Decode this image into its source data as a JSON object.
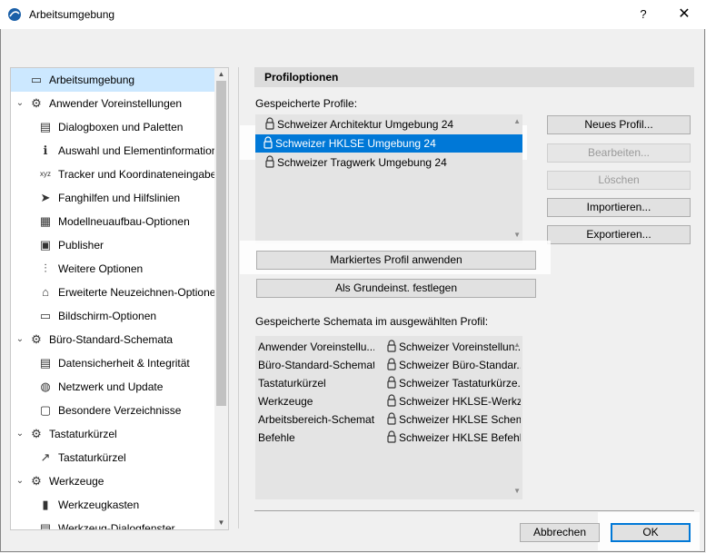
{
  "window": {
    "title": "Arbeitsumgebung",
    "help": "?",
    "close": "✕"
  },
  "tree": {
    "items": [
      {
        "label": "Arbeitsumgebung",
        "level": 0,
        "selected": true,
        "expander": "",
        "icon": "monitor-icon"
      },
      {
        "label": "Anwender Voreinstellungen",
        "level": 0,
        "expander": "⌄",
        "icon": "user-settings-icon"
      },
      {
        "label": "Dialogboxen und Paletten",
        "level": 1,
        "icon": "dialog-icon"
      },
      {
        "label": "Auswahl und Elementinformation",
        "level": 1,
        "icon": "selection-info-icon"
      },
      {
        "label": "Tracker und Koordinateneingabe",
        "level": 1,
        "icon": "xyz-icon"
      },
      {
        "label": "Fanghilfen und Hilfslinien",
        "level": 1,
        "icon": "cursor-icon"
      },
      {
        "label": "Modellneuaufbau-Optionen",
        "level": 1,
        "icon": "brick-icon"
      },
      {
        "label": "Publisher",
        "level": 1,
        "icon": "publisher-icon"
      },
      {
        "label": "Weitere Optionen",
        "level": 1,
        "icon": "sliders-icon"
      },
      {
        "label": "Erweiterte Neuzeichnen-Optionen",
        "level": 1,
        "icon": "house-icon"
      },
      {
        "label": "Bildschirm-Optionen",
        "level": 1,
        "icon": "screen-icon"
      },
      {
        "label": "Büro-Standard-Schemata",
        "level": 0,
        "expander": "⌄",
        "icon": "office-schema-icon"
      },
      {
        "label": "Datensicherheit & Integrität",
        "level": 1,
        "icon": "data-safety-icon"
      },
      {
        "label": "Netzwerk und Update",
        "level": 1,
        "icon": "globe-icon"
      },
      {
        "label": "Besondere Verzeichnisse",
        "level": 1,
        "icon": "folder-icon"
      },
      {
        "label": "Tastaturkürzel",
        "level": 0,
        "expander": "⌄",
        "icon": "keyboard-schema-icon"
      },
      {
        "label": "Tastaturkürzel",
        "level": 1,
        "icon": "shortcut-icon"
      },
      {
        "label": "Werkzeuge",
        "level": 0,
        "expander": "⌄",
        "icon": "tools-icon"
      },
      {
        "label": "Werkzeugkasten",
        "level": 1,
        "icon": "toolbox-icon"
      },
      {
        "label": "Werkzeug-Dialogfenster",
        "level": 1,
        "icon": "tool-dialog-icon"
      }
    ]
  },
  "panel": {
    "header": "Profiloptionen",
    "saved_profiles_label": "Gespeicherte Profile:",
    "profiles": [
      {
        "name": "Schweizer Architektur Umgebung 24",
        "selected": false
      },
      {
        "name": "Schweizer HKLSE Umgebung 24",
        "selected": true
      },
      {
        "name": "Schweizer Tragwerk Umgebung 24",
        "selected": false
      }
    ],
    "buttons": {
      "new_profile": "Neues Profil...",
      "edit": "Bearbeiten...",
      "delete": "Löschen",
      "import": "Importieren...",
      "export": "Exportieren...",
      "apply_selected": "Markiertes Profil anwenden",
      "set_default": "Als Grundeinst. festlegen"
    },
    "schemes_label": "Gespeicherte Schemata im ausgewählten Profil:",
    "schemes": [
      {
        "type": "Anwender Voreinstellu...",
        "value": "Schweizer Voreinstellun..."
      },
      {
        "type": "Büro-Standard-Schemata",
        "value": "Schweizer Büro-Standar..."
      },
      {
        "type": "Tastaturkürzel",
        "value": "Schweizer Tastaturkürze..."
      },
      {
        "type": "Werkzeuge",
        "value": "Schweizer HKLSE-Werkz..."
      },
      {
        "type": "Arbeitsbereich-Schemata",
        "value": "Schweizer HKLSE Schem..."
      },
      {
        "type": "Befehle",
        "value": "Schweizer HKLSE Befehl..."
      }
    ]
  },
  "footer": {
    "cancel": "Abbrechen",
    "ok": "OK"
  },
  "colors": {
    "selection": "#0078d7",
    "tree_selection": "#cce8ff"
  }
}
